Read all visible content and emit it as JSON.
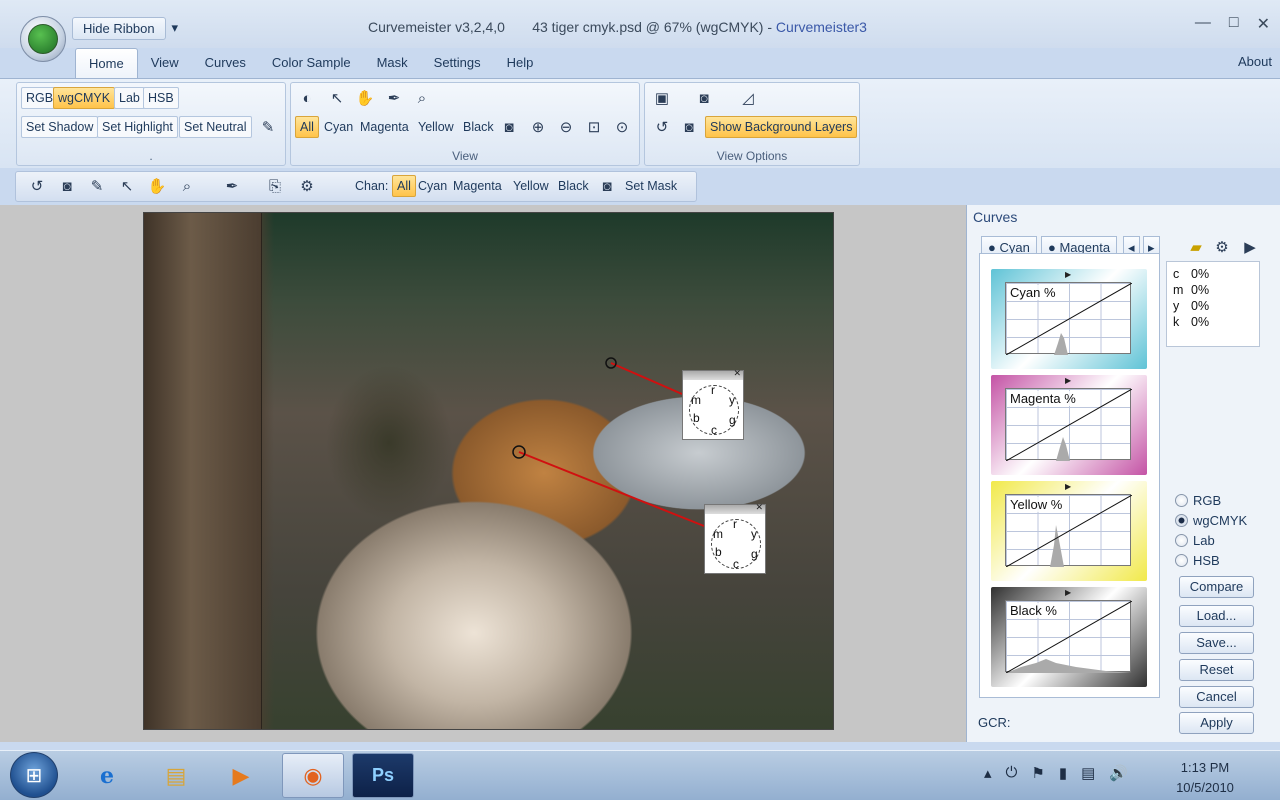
{
  "window": {
    "app_name": "Curvemeister v3,2,4,0",
    "document": "43 tiger cmyk.psd @ 67% (wgCMYK)",
    "separator": " - ",
    "app_short": "Curvemeister3",
    "hide_ribbon": "Hide Ribbon",
    "qat_arrow": "▾",
    "minimize": "—",
    "maximize": "□",
    "close": "✕"
  },
  "menu_tabs": [
    "Home",
    "View",
    "Curves",
    "Color Sample",
    "Mask",
    "Settings",
    "Help"
  ],
  "about": "About",
  "ribbon": {
    "mode_buttons": [
      "RGB",
      "wgCMYK",
      "Lab",
      "HSB"
    ],
    "set_buttons": [
      "Set Shadow",
      "Set Highlight",
      "Set Neutral"
    ],
    "group1_label": ".",
    "channel_buttons": [
      "All",
      "Cyan",
      "Magenta",
      "Yellow",
      "Black"
    ],
    "group2_label": "View",
    "show_bg": "Show Background Layers",
    "group3_label": "View Options"
  },
  "toolbar": {
    "chan_label": "Chan:",
    "channels": [
      "All",
      "Cyan",
      "Magenta",
      "Yellow",
      "Black"
    ],
    "set_mask": "Set Mask"
  },
  "samplers": [
    {
      "labels": [
        "r",
        "y",
        "g",
        "c",
        "b",
        "m"
      ],
      "close": "✕"
    },
    {
      "labels": [
        "r",
        "y",
        "g",
        "c",
        "b",
        "m"
      ],
      "close": "✕"
    }
  ],
  "curves_panel": {
    "title": "Curves",
    "tabs": [
      "Cyan",
      "Magenta"
    ],
    "nav_prev": "◂",
    "nav_next": "▸",
    "curves": [
      {
        "label": "Cyan %",
        "color": "#5fc3d6"
      },
      {
        "label": "Magenta %",
        "color": "#c453a5"
      },
      {
        "label": "Yellow %",
        "color": "#f1e94a"
      },
      {
        "label": "Black %",
        "color": "#303030"
      }
    ],
    "readout": [
      {
        "ch": "c",
        "val": "0%"
      },
      {
        "ch": "m",
        "val": "0%"
      },
      {
        "ch": "y",
        "val": "0%"
      },
      {
        "ch": "k",
        "val": "0%"
      }
    ],
    "modes": [
      "RGB",
      "wgCMYK",
      "Lab",
      "HSB"
    ],
    "selected_mode": "wgCMYK",
    "buttons": [
      "Compare",
      "Load...",
      "Save...",
      "Reset",
      "Cancel",
      "Apply"
    ],
    "gcr_label": "GCR:"
  },
  "taskbar": {
    "start": "⊞",
    "apps": [
      {
        "name": "Internet Explorer",
        "glyph": "e"
      },
      {
        "name": "Windows Explorer",
        "glyph": "▤"
      },
      {
        "name": "Media Player",
        "glyph": "▶"
      },
      {
        "name": "Firefox",
        "glyph": "◉"
      },
      {
        "name": "Photoshop",
        "glyph": "Ps"
      }
    ],
    "tray_icons": [
      "▴",
      "⏻",
      "⚑",
      "▮",
      "▤",
      "🔊"
    ],
    "time": "1:13 PM",
    "date": "10/5/2010"
  }
}
